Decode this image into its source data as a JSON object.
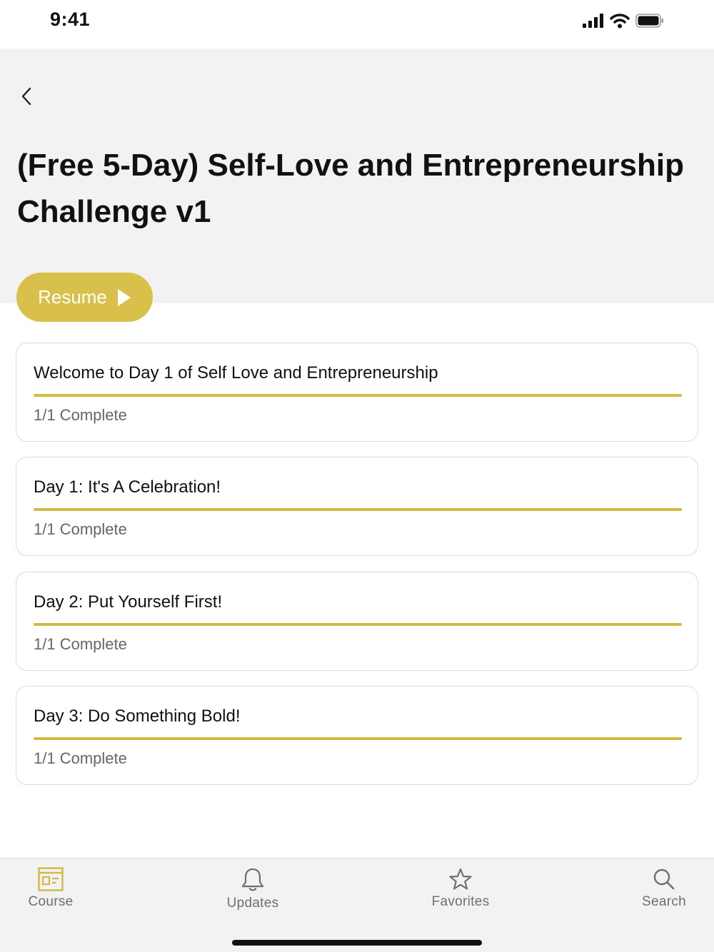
{
  "status_bar": {
    "time": "9:41"
  },
  "header": {
    "back_icon": "chevron-left-icon",
    "title": "(Free 5-Day) Self-Love and Entrepreneurship Challenge v1"
  },
  "resume": {
    "label": "Resume",
    "icon": "play-icon"
  },
  "accent_color": "#d8c04a",
  "lessons": [
    {
      "title": "Welcome to Day 1 of Self Love and Entrepreneurship",
      "status": "1/1 Complete",
      "progress": 1.0
    },
    {
      "title": "Day 1: It's A Celebration!",
      "status": "1/1 Complete",
      "progress": 1.0
    },
    {
      "title": "Day 2: Put Yourself First!",
      "status": "1/1 Complete",
      "progress": 1.0
    },
    {
      "title": "Day 3: Do Something Bold!",
      "status": "1/1 Complete",
      "progress": 1.0
    }
  ],
  "tab_bar": {
    "tabs": [
      {
        "label": "Course",
        "icon": "course-icon",
        "active": true
      },
      {
        "label": "Updates",
        "icon": "bell-icon",
        "active": false
      },
      {
        "label": "Favorites",
        "icon": "star-icon",
        "active": false
      },
      {
        "label": "Search",
        "icon": "search-icon",
        "active": false
      }
    ]
  }
}
